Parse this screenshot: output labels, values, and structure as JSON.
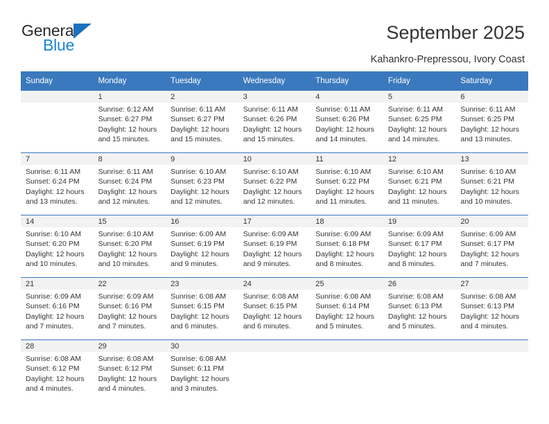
{
  "brand": {
    "name_top": "General",
    "name_bottom": "Blue",
    "accent_color": "#1b86d6",
    "triangle_color": "#1b72bb"
  },
  "header": {
    "title": "September 2025",
    "subtitle": "Kahankro-Prepressou, Ivory Coast"
  },
  "calendar": {
    "header_bg": "#3a79bd",
    "daynum_bg": "#f2f2f2",
    "weekday_headers": [
      "Sunday",
      "Monday",
      "Tuesday",
      "Wednesday",
      "Thursday",
      "Friday",
      "Saturday"
    ],
    "weeks": [
      [
        {
          "day": "",
          "sunrise": "",
          "sunset": "",
          "daylight1": "",
          "daylight2": "",
          "blank": true
        },
        {
          "day": "1",
          "sunrise": "Sunrise: 6:12 AM",
          "sunset": "Sunset: 6:27 PM",
          "daylight1": "Daylight: 12 hours",
          "daylight2": "and 15 minutes."
        },
        {
          "day": "2",
          "sunrise": "Sunrise: 6:11 AM",
          "sunset": "Sunset: 6:27 PM",
          "daylight1": "Daylight: 12 hours",
          "daylight2": "and 15 minutes."
        },
        {
          "day": "3",
          "sunrise": "Sunrise: 6:11 AM",
          "sunset": "Sunset: 6:26 PM",
          "daylight1": "Daylight: 12 hours",
          "daylight2": "and 15 minutes."
        },
        {
          "day": "4",
          "sunrise": "Sunrise: 6:11 AM",
          "sunset": "Sunset: 6:26 PM",
          "daylight1": "Daylight: 12 hours",
          "daylight2": "and 14 minutes."
        },
        {
          "day": "5",
          "sunrise": "Sunrise: 6:11 AM",
          "sunset": "Sunset: 6:25 PM",
          "daylight1": "Daylight: 12 hours",
          "daylight2": "and 14 minutes."
        },
        {
          "day": "6",
          "sunrise": "Sunrise: 6:11 AM",
          "sunset": "Sunset: 6:25 PM",
          "daylight1": "Daylight: 12 hours",
          "daylight2": "and 13 minutes."
        }
      ],
      [
        {
          "day": "7",
          "sunrise": "Sunrise: 6:11 AM",
          "sunset": "Sunset: 6:24 PM",
          "daylight1": "Daylight: 12 hours",
          "daylight2": "and 13 minutes."
        },
        {
          "day": "8",
          "sunrise": "Sunrise: 6:11 AM",
          "sunset": "Sunset: 6:24 PM",
          "daylight1": "Daylight: 12 hours",
          "daylight2": "and 12 minutes."
        },
        {
          "day": "9",
          "sunrise": "Sunrise: 6:10 AM",
          "sunset": "Sunset: 6:23 PM",
          "daylight1": "Daylight: 12 hours",
          "daylight2": "and 12 minutes."
        },
        {
          "day": "10",
          "sunrise": "Sunrise: 6:10 AM",
          "sunset": "Sunset: 6:22 PM",
          "daylight1": "Daylight: 12 hours",
          "daylight2": "and 12 minutes."
        },
        {
          "day": "11",
          "sunrise": "Sunrise: 6:10 AM",
          "sunset": "Sunset: 6:22 PM",
          "daylight1": "Daylight: 12 hours",
          "daylight2": "and 11 minutes."
        },
        {
          "day": "12",
          "sunrise": "Sunrise: 6:10 AM",
          "sunset": "Sunset: 6:21 PM",
          "daylight1": "Daylight: 12 hours",
          "daylight2": "and 11 minutes."
        },
        {
          "day": "13",
          "sunrise": "Sunrise: 6:10 AM",
          "sunset": "Sunset: 6:21 PM",
          "daylight1": "Daylight: 12 hours",
          "daylight2": "and 10 minutes."
        }
      ],
      [
        {
          "day": "14",
          "sunrise": "Sunrise: 6:10 AM",
          "sunset": "Sunset: 6:20 PM",
          "daylight1": "Daylight: 12 hours",
          "daylight2": "and 10 minutes."
        },
        {
          "day": "15",
          "sunrise": "Sunrise: 6:10 AM",
          "sunset": "Sunset: 6:20 PM",
          "daylight1": "Daylight: 12 hours",
          "daylight2": "and 10 minutes."
        },
        {
          "day": "16",
          "sunrise": "Sunrise: 6:09 AM",
          "sunset": "Sunset: 6:19 PM",
          "daylight1": "Daylight: 12 hours",
          "daylight2": "and 9 minutes."
        },
        {
          "day": "17",
          "sunrise": "Sunrise: 6:09 AM",
          "sunset": "Sunset: 6:19 PM",
          "daylight1": "Daylight: 12 hours",
          "daylight2": "and 9 minutes."
        },
        {
          "day": "18",
          "sunrise": "Sunrise: 6:09 AM",
          "sunset": "Sunset: 6:18 PM",
          "daylight1": "Daylight: 12 hours",
          "daylight2": "and 8 minutes."
        },
        {
          "day": "19",
          "sunrise": "Sunrise: 6:09 AM",
          "sunset": "Sunset: 6:17 PM",
          "daylight1": "Daylight: 12 hours",
          "daylight2": "and 8 minutes."
        },
        {
          "day": "20",
          "sunrise": "Sunrise: 6:09 AM",
          "sunset": "Sunset: 6:17 PM",
          "daylight1": "Daylight: 12 hours",
          "daylight2": "and 7 minutes."
        }
      ],
      [
        {
          "day": "21",
          "sunrise": "Sunrise: 6:09 AM",
          "sunset": "Sunset: 6:16 PM",
          "daylight1": "Daylight: 12 hours",
          "daylight2": "and 7 minutes."
        },
        {
          "day": "22",
          "sunrise": "Sunrise: 6:09 AM",
          "sunset": "Sunset: 6:16 PM",
          "daylight1": "Daylight: 12 hours",
          "daylight2": "and 7 minutes."
        },
        {
          "day": "23",
          "sunrise": "Sunrise: 6:08 AM",
          "sunset": "Sunset: 6:15 PM",
          "daylight1": "Daylight: 12 hours",
          "daylight2": "and 6 minutes."
        },
        {
          "day": "24",
          "sunrise": "Sunrise: 6:08 AM",
          "sunset": "Sunset: 6:15 PM",
          "daylight1": "Daylight: 12 hours",
          "daylight2": "and 6 minutes."
        },
        {
          "day": "25",
          "sunrise": "Sunrise: 6:08 AM",
          "sunset": "Sunset: 6:14 PM",
          "daylight1": "Daylight: 12 hours",
          "daylight2": "and 5 minutes."
        },
        {
          "day": "26",
          "sunrise": "Sunrise: 6:08 AM",
          "sunset": "Sunset: 6:13 PM",
          "daylight1": "Daylight: 12 hours",
          "daylight2": "and 5 minutes."
        },
        {
          "day": "27",
          "sunrise": "Sunrise: 6:08 AM",
          "sunset": "Sunset: 6:13 PM",
          "daylight1": "Daylight: 12 hours",
          "daylight2": "and 4 minutes."
        }
      ],
      [
        {
          "day": "28",
          "sunrise": "Sunrise: 6:08 AM",
          "sunset": "Sunset: 6:12 PM",
          "daylight1": "Daylight: 12 hours",
          "daylight2": "and 4 minutes."
        },
        {
          "day": "29",
          "sunrise": "Sunrise: 6:08 AM",
          "sunset": "Sunset: 6:12 PM",
          "daylight1": "Daylight: 12 hours",
          "daylight2": "and 4 minutes."
        },
        {
          "day": "30",
          "sunrise": "Sunrise: 6:08 AM",
          "sunset": "Sunset: 6:11 PM",
          "daylight1": "Daylight: 12 hours",
          "daylight2": "and 3 minutes."
        },
        {
          "day": "",
          "sunrise": "",
          "sunset": "",
          "daylight1": "",
          "daylight2": "",
          "blank": true
        },
        {
          "day": "",
          "sunrise": "",
          "sunset": "",
          "daylight1": "",
          "daylight2": "",
          "blank": true
        },
        {
          "day": "",
          "sunrise": "",
          "sunset": "",
          "daylight1": "",
          "daylight2": "",
          "blank": true
        },
        {
          "day": "",
          "sunrise": "",
          "sunset": "",
          "daylight1": "",
          "daylight2": "",
          "blank": true
        }
      ]
    ]
  }
}
